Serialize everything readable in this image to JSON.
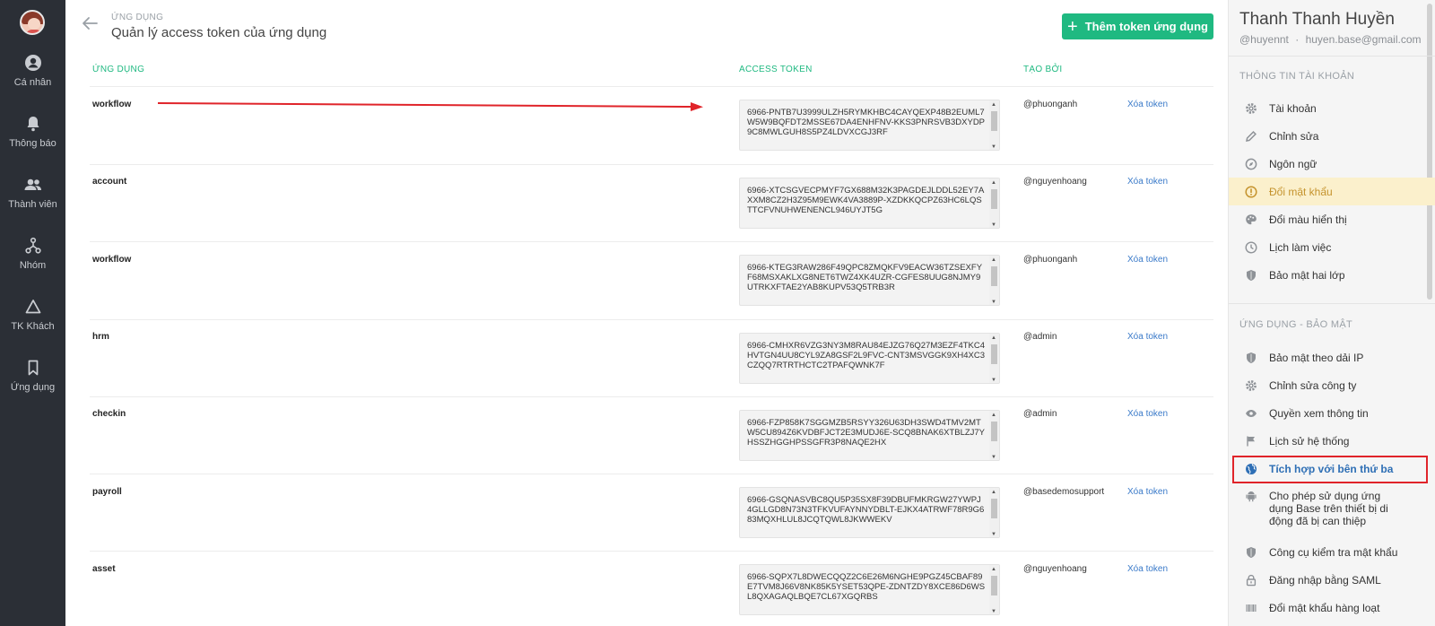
{
  "nav": {
    "items": [
      {
        "label": "Cá nhân",
        "icon": "person-icon"
      },
      {
        "label": "Thông báo",
        "icon": "bell-icon"
      },
      {
        "label": "Thành viên",
        "icon": "members-icon"
      },
      {
        "label": "Nhóm",
        "icon": "group-icon"
      },
      {
        "label": "TK Khách",
        "icon": "guest-triangle-icon"
      },
      {
        "label": "Ứng dụng",
        "icon": "bookmark-icon"
      }
    ]
  },
  "header": {
    "breadcrumb": "ỨNG DỤNG",
    "title": "Quản lý access token của ứng dụng",
    "add_button": "Thêm token ứng dụng"
  },
  "table": {
    "columns": [
      "ỨNG DỤNG",
      "ACCESS TOKEN",
      "TẠO BỞI"
    ],
    "delete_label": "Xóa token",
    "rows": [
      {
        "app": "workflow",
        "token": "6966-PNTB7U3999ULZH5RYMKHBC4CAYQEXP48B2EUML7W5W9BQFDT2MSSE67DA4ENHFNV-KKS3PNRSVB3DXYDP9C8MWLGUH8S5PZ4LDVXCGJ3RF",
        "by": "@phuonganh"
      },
      {
        "app": "account",
        "token": "6966-XTCSGVECPMYF7GX688M32K3PAGDEJLDDL52EY7AXXM8CZ2H3Z95M9EWK4VA3889P-XZDKKQCPZ63HC6LQSTTCFVNUHWENENCL946UYJT5G",
        "by": "@nguyenhoang"
      },
      {
        "app": "workflow",
        "token": "6966-KTEG3RAW286F49QPC8ZMQKFV9EACW36TZSEXFYF68MSXAKLXG8NET6TWZ4XK4UZR-CGFES8UUG8NJMY9UTRKXFTAE2YAB8KUPV53Q5TRB3R",
        "by": "@phuonganh"
      },
      {
        "app": "hrm",
        "token": "6966-CMHXR6VZG3NY3M8RAU84EJZG76Q27M3EZF4TKC4HVTGN4UU8CYL9ZA8GSF2L9FVC-CNT3MSVGGK9XH4XC3CZQQ7RTRTHCTC2TPAFQWNK7F",
        "by": "@admin"
      },
      {
        "app": "checkin",
        "token": "6966-FZP858K7SGGMZB5RSYY326U63DH3SWD4TMV2MTW5CU894Z6KVDBFJCT2E3MUDJ6E-SCQ8BNAK6XTBLZJ7YHSSZHGGHPSSGFR3P8NAQE2HX",
        "by": "@admin"
      },
      {
        "app": "payroll",
        "token": "6966-GSQNASVBC8QU5P35SX8F39DBUFMKRGW27YWPJ4GLLGD8N73N3TFKVUFAYNNYDBLT-EJKX4ATRWF78R9G683MQXHLUL8JCQTQWL8JKWWEKV",
        "by": "@basedemosupport"
      },
      {
        "app": "asset",
        "token": "6966-SQPX7L8DWECQQZ2C6E26M6NGHE9PGZ45CBAF89E7TVM8J66V8NK85K5YSET53QPE-ZDNTZDY8XCE86D6WSL8QXAGAQLBQE7CL67XGQRBS",
        "by": "@nguyenhoang"
      }
    ]
  },
  "profile": {
    "name": "Thanh Thanh Huyền",
    "handle": "@huyennt",
    "separator": "·",
    "email": "huyen.base@gmail.com"
  },
  "account_section": {
    "title": "THÔNG TIN TÀI KHOẢN",
    "items": [
      {
        "label": "Tài khoản",
        "icon": "gear-icon"
      },
      {
        "label": "Chỉnh sửa",
        "icon": "pencil-icon"
      },
      {
        "label": "Ngôn ngữ",
        "icon": "compass-icon"
      },
      {
        "label": "Đổi mật khẩu",
        "icon": "alert-circle-icon"
      },
      {
        "label": "Đổi màu hiển thị",
        "icon": "palette-icon"
      },
      {
        "label": "Lịch làm việc",
        "icon": "clock-icon"
      },
      {
        "label": "Bảo mật hai lớp",
        "icon": "shield-icon"
      }
    ]
  },
  "security_section": {
    "title": "ỨNG DỤNG - BẢO MẬT",
    "items": [
      {
        "label": "Bảo mật theo dải IP",
        "icon": "shield-icon"
      },
      {
        "label": "Chỉnh sửa công ty",
        "icon": "gear-icon"
      },
      {
        "label": "Quyền xem thông tin",
        "icon": "eye-icon"
      },
      {
        "label": "Lịch sử hệ thống",
        "icon": "flag-icon"
      },
      {
        "label": "Tích hợp với bên thứ ba",
        "icon": "globe-icon"
      },
      {
        "label": "Cho phép sử dụng ứng dụng Base trên thiết bị di động đã bị can thiệp",
        "icon": "android-icon"
      },
      {
        "label": "Công cụ kiểm tra mật khẩu",
        "icon": "shield-icon"
      },
      {
        "label": "Đăng nhập bằng SAML",
        "icon": "lock-icon"
      },
      {
        "label": "Đổi mật khẩu hàng loạt",
        "icon": "barcode-icon"
      }
    ]
  },
  "colors": {
    "accent": "#1fb981",
    "link": "#3a7ac9",
    "active_bg": "#fbf0cc",
    "active_text": "#c5932d",
    "annotation_red": "#e0242a"
  }
}
